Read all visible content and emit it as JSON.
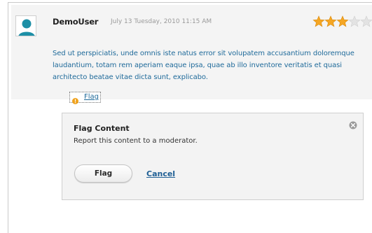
{
  "comment": {
    "username": "DemoUser",
    "timestamp": "July 13 Tuesday, 2010 11:15 AM",
    "rating": {
      "value": 3,
      "max": 5
    },
    "body": "Sed ut perspiciatis, unde omnis iste natus error sit volupatem accusantium doloremque laudantium, totam rem aperiam eaque ipsa, quae ab illo inventore veritatis et quasi architecto beatae vitae dicta sunt, explicabo.",
    "flag_link_label": "Flag",
    "avatar_icon": "user-avatar-icon",
    "warning_icon": "warning-icon"
  },
  "flag_panel": {
    "title": "Flag Content",
    "description": "Report this content to a moderator.",
    "flag_button_label": "Flag",
    "cancel_label": "Cancel",
    "close_icon": "close-icon"
  },
  "colors": {
    "star_filled": "#f5a623",
    "star_empty": "#e3e3e3",
    "link": "#1f6a9a",
    "warning": "#f0a21c"
  }
}
